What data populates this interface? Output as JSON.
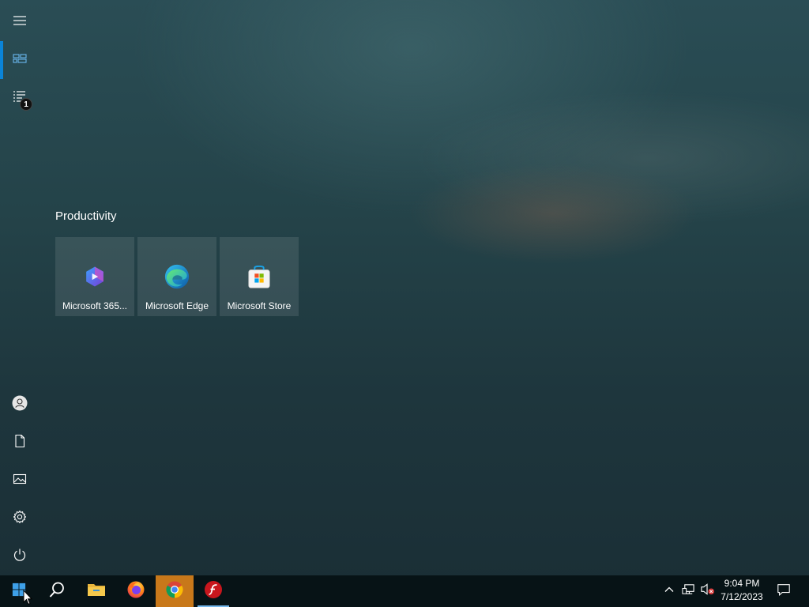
{
  "start_menu": {
    "rail": {
      "expand": {
        "icon": "hamburger-icon"
      },
      "tiles_view": {
        "icon": "tiles-icon",
        "active": true
      },
      "all_apps": {
        "icon": "all-apps-list-icon",
        "badge": "1"
      },
      "user": {
        "icon": "user-icon"
      },
      "documents": {
        "icon": "document-icon"
      },
      "pictures": {
        "icon": "pictures-icon"
      },
      "settings": {
        "icon": "gear-icon"
      },
      "power": {
        "icon": "power-icon"
      }
    },
    "group": {
      "title": "Productivity",
      "tiles": [
        {
          "label": "Microsoft 365...",
          "icon": "microsoft-365-icon"
        },
        {
          "label": "Microsoft Edge",
          "icon": "edge-icon"
        },
        {
          "label": "Microsoft Store",
          "icon": "store-icon"
        }
      ]
    }
  },
  "taskbar": {
    "start": {
      "icon": "windows-logo-icon"
    },
    "search": {
      "icon": "search-icon"
    },
    "pinned": [
      {
        "name": "File Explorer",
        "icon": "folder-icon",
        "running": false
      },
      {
        "name": "Firefox",
        "icon": "firefox-icon",
        "running": false
      },
      {
        "name": "Google Chrome",
        "icon": "chrome-icon",
        "running": false,
        "highlighted": true
      },
      {
        "name": "Adobe Flash",
        "icon": "flash-icon",
        "running": true
      }
    ],
    "tray": {
      "overflow": {
        "icon": "chevron-up-icon"
      },
      "network": {
        "icon": "network-icon"
      },
      "volume": {
        "icon": "volume-muted-icon"
      },
      "time": "9:04 PM",
      "date": "7/12/2023",
      "notifications": {
        "icon": "notification-icon"
      }
    }
  },
  "colors": {
    "accent": "#0a84d8",
    "taskbar": "#071316",
    "chrome_highlight": "#c8781a"
  }
}
